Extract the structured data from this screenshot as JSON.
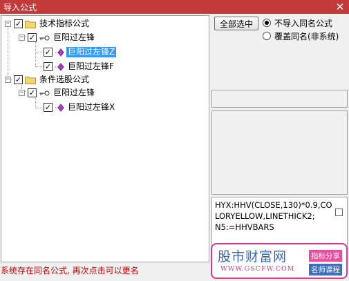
{
  "window": {
    "title": "导入公式",
    "close_glyph": "✕"
  },
  "tree": {
    "groups": [
      {
        "label": "技术指标公式",
        "expanded": true,
        "checked": true,
        "icon": "folder-icon",
        "children": [
          {
            "label": "巨阳过左锋",
            "expanded": true,
            "checked": true,
            "icon": "key-icon",
            "children": [
              {
                "label": "巨阳过左锋Z",
                "checked": true,
                "selected": true,
                "icon": "diamond-icon"
              },
              {
                "label": "巨阳过左锋F",
                "checked": true,
                "selected": false,
                "icon": "diamond-icon"
              }
            ]
          }
        ]
      },
      {
        "label": "条件选股公式",
        "expanded": true,
        "checked": true,
        "icon": "folder-icon",
        "children": [
          {
            "label": "巨阳过左锋",
            "expanded": true,
            "checked": true,
            "icon": "key-icon",
            "children": [
              {
                "label": "巨阳过左锋X",
                "checked": true,
                "selected": false,
                "icon": "diamond-icon"
              }
            ]
          }
        ]
      }
    ]
  },
  "controls": {
    "select_all_label": "全部选中",
    "option_skip_label": "不导入同名公式",
    "option_overwrite_label": "覆盖同名(非系统)",
    "selected_option": "skip"
  },
  "preview": {
    "code": "HYX:HHV(CLOSE,130)*0.9,COLORYELLOW,LINETHICK2;\nN5:=HHVBARS"
  },
  "status": {
    "message": "系统存在同名公式, 再次点击可以更名"
  },
  "watermark": {
    "brand": "股市财富网",
    "url": "WWW.GSCFW.COM",
    "tag_1": "指标分享",
    "tag_2": "名师课程",
    "colors": {
      "pink": "#e0338a",
      "blue": "#3768b8"
    }
  },
  "colors": {
    "titlebar": "#c33a3a",
    "selection": "#3399ff",
    "status_text": "#c00000"
  }
}
